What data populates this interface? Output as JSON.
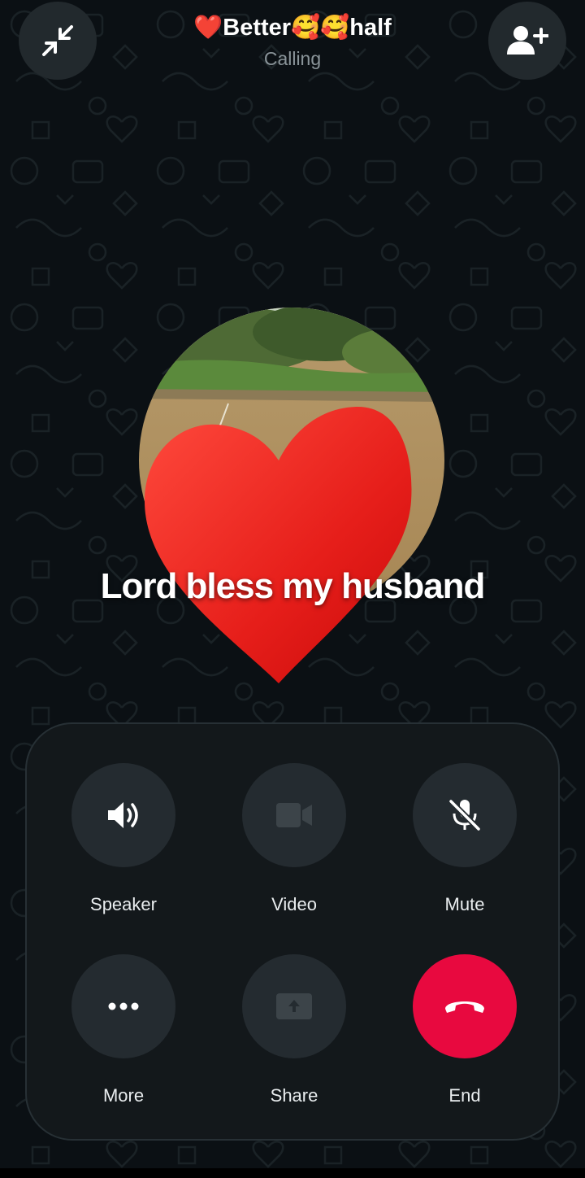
{
  "call": {
    "caller_name": "❤️Better🥰🥰half",
    "status": "Calling",
    "avatar_caption": "Lord bless my husband"
  },
  "top_bar": {
    "minimize_icon": "collapse-arrows-icon",
    "add_participant_icon": "add-person-icon"
  },
  "controls": [
    {
      "label": "Speaker",
      "icon": "speaker-icon"
    },
    {
      "label": "Video",
      "icon": "video-camera-icon"
    },
    {
      "label": "Mute",
      "icon": "mic-off-icon"
    },
    {
      "label": "More",
      "icon": "more-dots-icon"
    },
    {
      "label": "Share",
      "icon": "screen-share-icon"
    },
    {
      "label": "End",
      "icon": "end-call-icon"
    }
  ],
  "colors": {
    "background": "#0b1014",
    "panel": "#13181b",
    "control_circle": "#242b30",
    "end_call": "#e8093f",
    "heart": "#e8241f"
  }
}
